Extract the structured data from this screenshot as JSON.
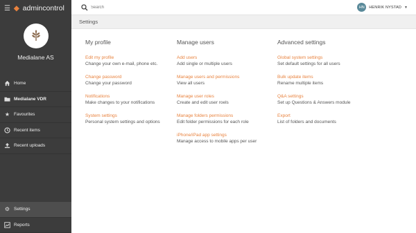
{
  "app": {
    "logo_text": "admincontrol"
  },
  "organization": {
    "name": "Medialane AS"
  },
  "sidebar": {
    "items": [
      {
        "label": "Home",
        "icon": "home-icon"
      },
      {
        "label": "Medialane VDR",
        "icon": "folder-icon"
      },
      {
        "label": "Favourites",
        "icon": "star-icon"
      },
      {
        "label": "Recent items",
        "icon": "clock-icon"
      },
      {
        "label": "Recent uploads",
        "icon": "upload-icon"
      }
    ],
    "bottom": [
      {
        "label": "Settings",
        "icon": "gear-icon"
      },
      {
        "label": "Reports",
        "icon": "chart-icon"
      }
    ]
  },
  "search": {
    "placeholder": "Search"
  },
  "user": {
    "initials": "HN",
    "name": "HENRIK NYSTAD"
  },
  "page": {
    "title": "Settings"
  },
  "columns": [
    {
      "heading": "My profile",
      "items": [
        {
          "link": "Edit my profile",
          "desc": "Change your own e-mail, phone etc."
        },
        {
          "link": "Change password",
          "desc": "Change your password"
        },
        {
          "link": "Notifications",
          "desc": "Make changes to your notifications"
        },
        {
          "link": "System settings",
          "desc": "Personal system settings and options"
        }
      ]
    },
    {
      "heading": "Manage users",
      "items": [
        {
          "link": "Add users",
          "desc": "Add single or multiple users"
        },
        {
          "link": "Manage users and permissions",
          "desc": "View all users"
        },
        {
          "link": "Manage user roles",
          "desc": "Create and edit user roels"
        },
        {
          "link": "Manage folders permissions",
          "desc": "Edit folder permissions for each role"
        },
        {
          "link": "iPhone/iPad app settings",
          "desc": "Manage access to mobile apps per user"
        }
      ]
    },
    {
      "heading": "Advanced settings",
      "items": [
        {
          "link": "Global system settings",
          "desc": "Set default settings for all users"
        },
        {
          "link": "Bulk update items",
          "desc": "Rename multiple items"
        },
        {
          "link": "Q&A settings",
          "desc": "Set up Questions & Answers  module"
        },
        {
          "link": "Export",
          "desc": "List of folders and documents"
        }
      ]
    }
  ],
  "colors": {
    "sidebar": "#3c3c3c",
    "accent": "#e8823e"
  }
}
